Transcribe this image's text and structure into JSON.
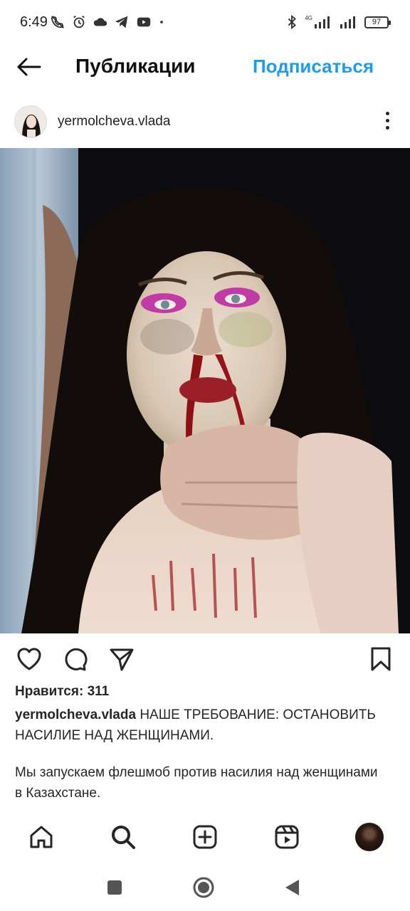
{
  "status_bar": {
    "time": "6:49",
    "network": "4G",
    "battery": "97"
  },
  "header": {
    "title": "Публикации",
    "follow_label": "Подписаться"
  },
  "post": {
    "username": "yermolcheva.vlada",
    "likes_text": "Нравится: 311",
    "caption_username": "yermolcheva.vlada",
    "caption_text": " НАШЕ ТРЕБОВАНИЕ: ОСТАНОВИТЬ НАСИЛИЕ НАД ЖЕНЩИНАМИ.",
    "caption_paragraph_2": "Мы запускаем флешмоб против насилия над женщинами в Казахстане."
  },
  "icons": {
    "back": "arrow-left-icon",
    "more": "more-vertical-icon",
    "like": "heart-icon",
    "comment": "comment-icon",
    "share": "send-icon",
    "save": "bookmark-icon",
    "home": "home-icon",
    "search": "search-icon",
    "create": "plus-square-icon",
    "reels": "reels-icon",
    "profile": "profile-avatar"
  },
  "colors": {
    "accent": "#1d9bf0",
    "text": "#262626"
  }
}
